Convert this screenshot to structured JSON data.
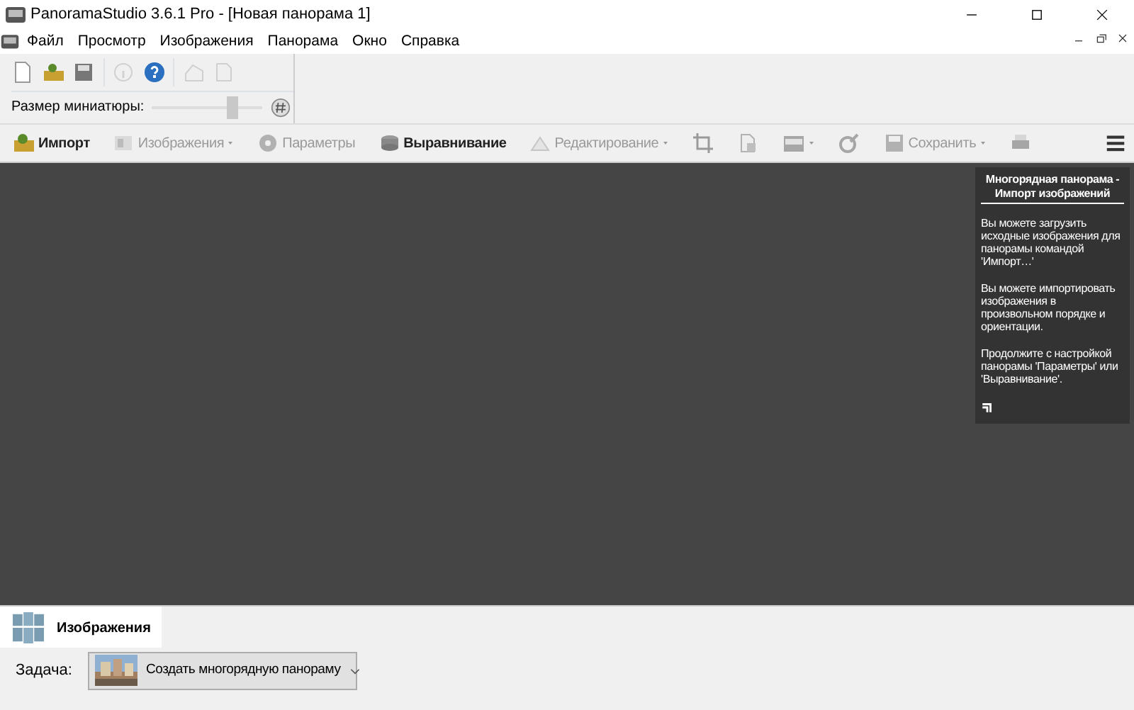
{
  "window": {
    "title": "PanoramaStudio 3.6.1 Pro - [Новая панорама 1]"
  },
  "menu": [
    "Файл",
    "Просмотр",
    "Изображения",
    "Панорама",
    "Окно",
    "Справка"
  ],
  "quick_toolbar": {
    "icons": [
      {
        "disabled": false
      },
      {
        "disabled": false
      },
      {
        "disabled": false
      },
      {
        "disabled": true
      },
      {
        "disabled": false
      },
      {
        "disabled": true
      },
      {
        "disabled": true
      }
    ],
    "thumb_label": "Размер миниатюры:",
    "thumb_slider": {
      "level": 0.75
    }
  },
  "toolbar": [
    {
      "kind": "button",
      "label": "Импорт",
      "disabled": false,
      "dropdown": false
    },
    {
      "kind": "button",
      "label": "Изображения",
      "disabled": true,
      "dropdown": true
    },
    {
      "kind": "button",
      "label": "Параметры",
      "disabled": true,
      "dropdown": false
    },
    {
      "kind": "button",
      "label": "Выравнивание",
      "disabled": false,
      "dropdown": false
    },
    {
      "kind": "button",
      "label": "Редактирование",
      "disabled": true,
      "dropdown": true
    },
    {
      "kind": "icon",
      "disabled": true,
      "dropdown": false
    },
    {
      "kind": "icon",
      "disabled": true,
      "dropdown": false
    },
    {
      "kind": "icon",
      "disabled": true,
      "dropdown": true
    },
    {
      "kind": "icon",
      "disabled": true,
      "dropdown": false
    },
    {
      "kind": "button",
      "label": "Сохранить",
      "disabled": true,
      "dropdown": true
    },
    {
      "kind": "icon",
      "disabled": true,
      "dropdown": false
    }
  ],
  "help_panel": {
    "title": "Многорядная панорама - Импорт изображений",
    "paragraphs": [
      "Вы можете загрузить исходные изображения для панорамы командой 'Импорт…'",
      "Вы можете импортировать изображения в произвольном порядке и ориентации.",
      "Продолжите с настройкой панорамы 'Параметры' или 'Выравнивание'."
    ]
  },
  "bottom_tabs": [
    {
      "label": "Изображения",
      "selected": true
    }
  ],
  "task": {
    "label": "Задача:",
    "value": "Создать многорядную панораму"
  }
}
